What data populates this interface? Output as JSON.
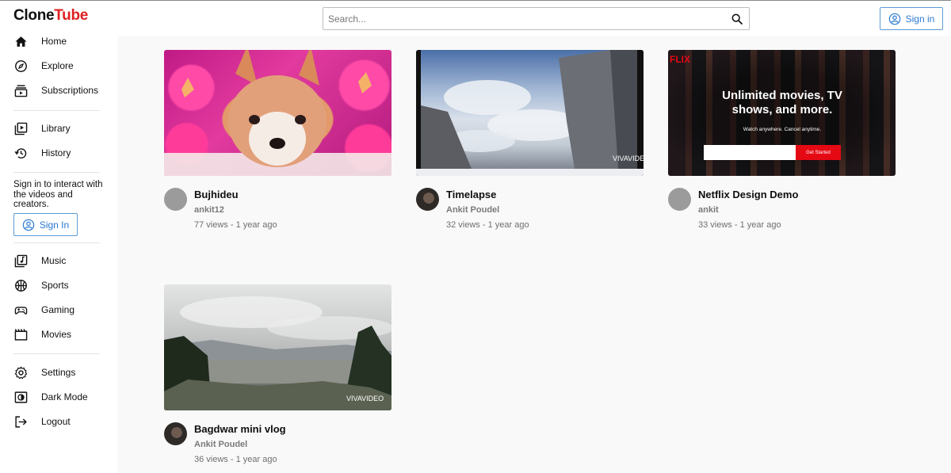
{
  "app": {
    "logo_part1": "Clone",
    "logo_part2": "Tube"
  },
  "header": {
    "search_placeholder": "Search...",
    "signin_label": "Sign in"
  },
  "sidebar": {
    "items": [
      {
        "label": "Home",
        "icon": "home-icon"
      },
      {
        "label": "Explore",
        "icon": "compass-icon"
      },
      {
        "label": "Subscriptions",
        "icon": "subscriptions-icon"
      },
      {
        "label": "Library",
        "icon": "library-icon"
      },
      {
        "label": "History",
        "icon": "history-icon"
      },
      {
        "label": "Music",
        "icon": "music-icon"
      },
      {
        "label": "Sports",
        "icon": "sports-icon"
      },
      {
        "label": "Gaming",
        "icon": "gaming-icon"
      },
      {
        "label": "Movies",
        "icon": "movies-icon"
      },
      {
        "label": "Settings",
        "icon": "settings-icon"
      },
      {
        "label": "Dark Mode",
        "icon": "dark-mode-icon"
      },
      {
        "label": "Logout",
        "icon": "logout-icon"
      }
    ],
    "signin_message": "Sign in to interact with the videos and creators.",
    "signin_label": "Sign In"
  },
  "videos": [
    {
      "title": "Bujhideu",
      "channel": "ankit12",
      "views": "77 views",
      "age": "1 year ago"
    },
    {
      "title": "Timelapse",
      "channel": "Ankit Poudel",
      "views": "32 views",
      "age": "1 year ago",
      "watermark": "VIVAVIDEO"
    },
    {
      "title": "Netflix Design Demo",
      "channel": "ankit",
      "views": "33 views",
      "age": "1 year ago",
      "thumb_headline": "Unlimited movies, TV shows, and more.",
      "thumb_sub": "Watch anywhere. Cancel anytime.",
      "thumb_cta": "Get Started",
      "thumb_brand": "FLIX"
    },
    {
      "title": "Bagdwar mini vlog",
      "channel": "Ankit Poudel",
      "views": "36 views",
      "age": "1 year ago",
      "watermark": "VIVAVIDEO"
    }
  ],
  "colors": {
    "brand_red": "#e02020",
    "signin_blue": "#2a7ad2",
    "background": "#f9f9f9"
  }
}
